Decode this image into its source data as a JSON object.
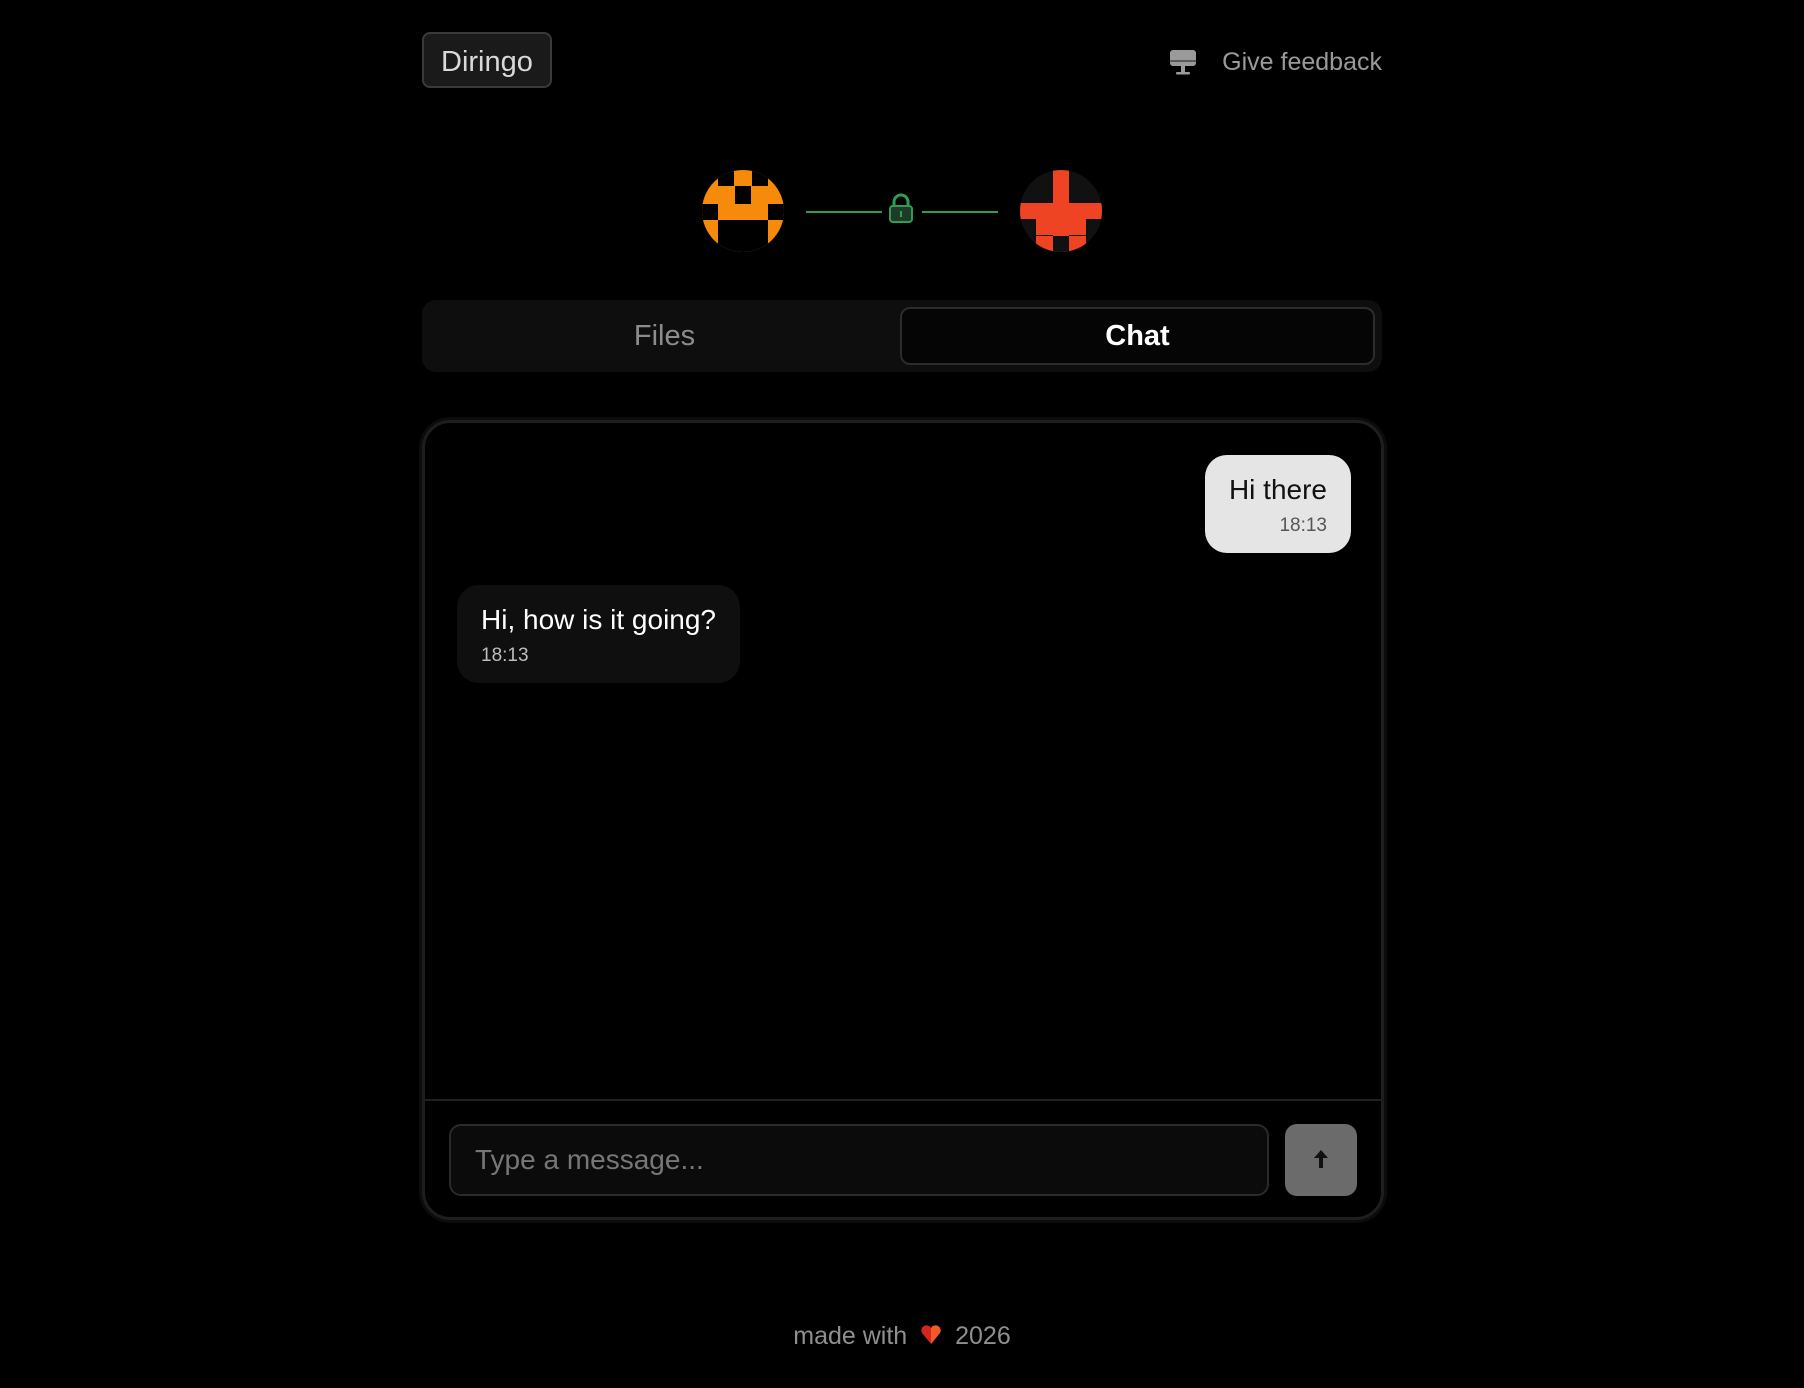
{
  "header": {
    "brand": "Diringo",
    "feedback_label": "Give feedback",
    "feedback_icon": "monitor-icon"
  },
  "connection": {
    "local_avatar_color": "#f68a0a",
    "remote_avatar_color": "#ee4423",
    "link_color": "#2e9e55",
    "lock_icon": "lock-icon"
  },
  "tabs": [
    {
      "label": "Files",
      "active": false
    },
    {
      "label": "Chat",
      "active": true
    }
  ],
  "chat": {
    "messages": [
      {
        "direction": "sent",
        "text": "Hi there",
        "time": "18:13"
      },
      {
        "direction": "received",
        "text": "Hi, how is it going?",
        "time": "18:13"
      }
    ],
    "input": {
      "placeholder": "Type a message...",
      "value": ""
    },
    "send_icon": "arrow-up-icon"
  },
  "footer": {
    "prefix": "made with",
    "heart_icon": "heart-icon",
    "year": "2026"
  }
}
